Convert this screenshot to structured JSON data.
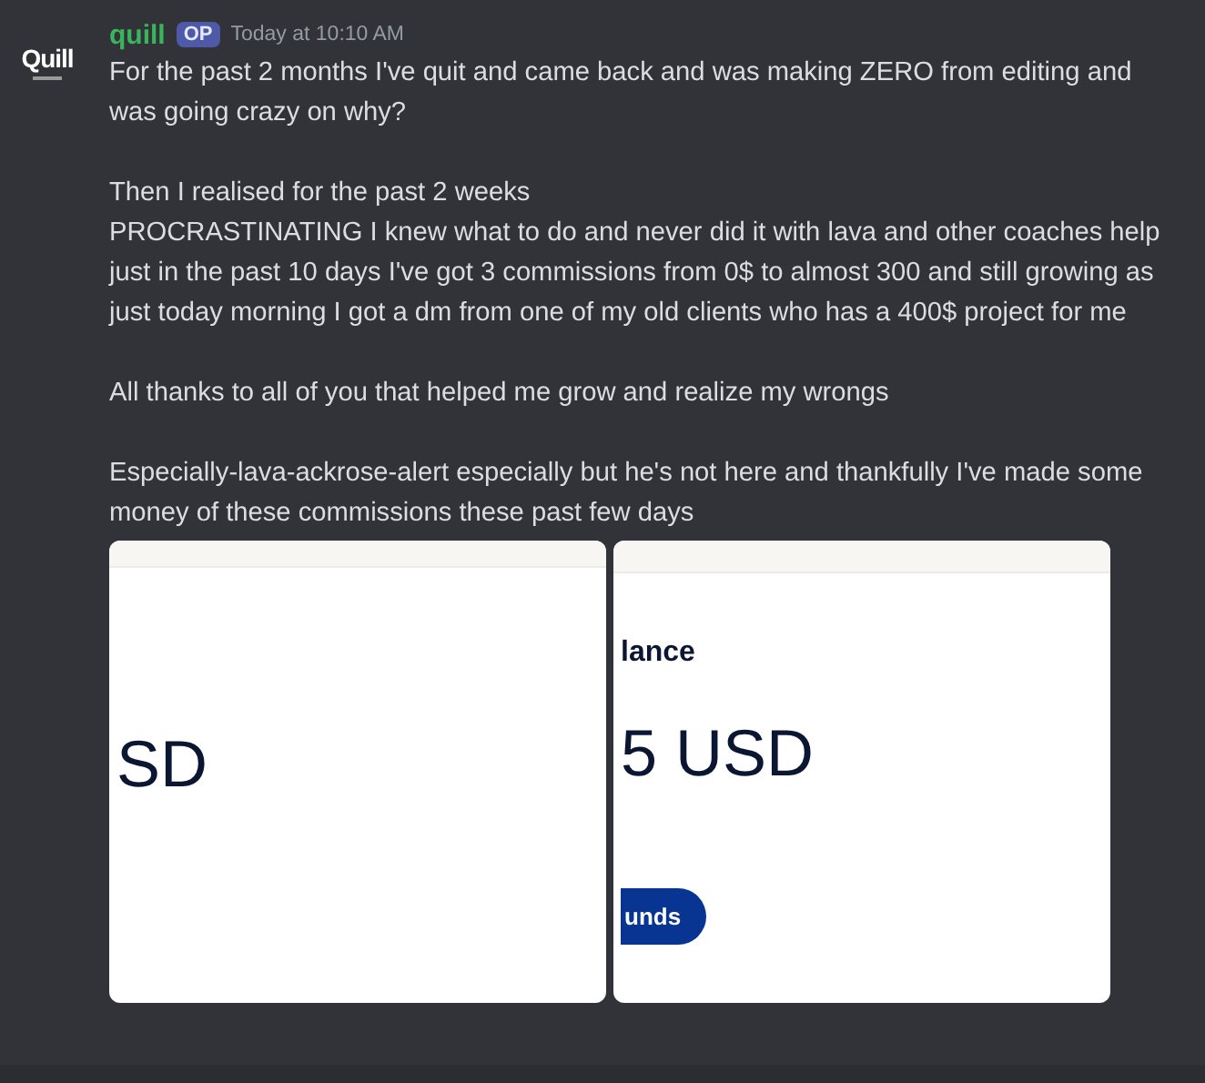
{
  "message": {
    "avatar_logo": "Quill",
    "author": "quill",
    "badge": "OP",
    "timestamp": "Today at 10:10 AM",
    "paragraphs": [
      "For the past 2 months I've quit and came back and was making ZERO from editing and was going crazy on why?",
      "Then I realised for the past 2 weeks\nPROCRASTINATING I knew what to do and never did it with lava and other coaches help just in the past 10 days I've got 3 commissions from 0$ to almost 300 and still growing as just today morning I got a dm from one of my old clients who has a 400$ project for me",
      "All thanks to all of you that helped me grow and realize my wrongs",
      "Especially-lava-ackrose-alert especially but he's not here and thankfully I've made some money of these commissions these past few days"
    ]
  },
  "attachments": [
    {
      "amount": "SD"
    },
    {
      "heading": "lance",
      "amount": "5 USD",
      "button": "unds"
    }
  ]
}
